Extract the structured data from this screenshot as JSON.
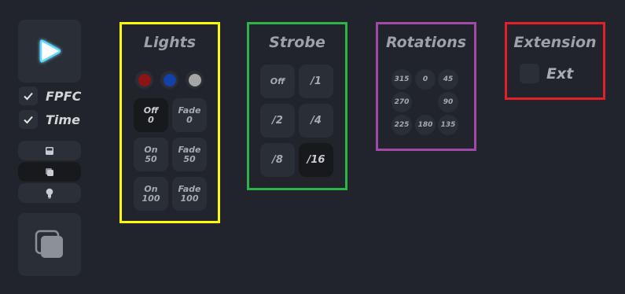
{
  "sidebar": {
    "toggles": [
      {
        "label": "FPFC",
        "checked": true
      },
      {
        "label": "Time",
        "checked": true
      }
    ],
    "play_icon": "play-icon",
    "layers_icon": "layers-icon"
  },
  "lights": {
    "title": "Lights",
    "colors": [
      "#8b1414",
      "#1540a8",
      "#a6a6a6"
    ],
    "buttons": [
      {
        "line1": "Off",
        "line2": "0"
      },
      {
        "line1": "Fade",
        "line2": "0"
      },
      {
        "line1": "On",
        "line2": "50"
      },
      {
        "line1": "Fade",
        "line2": "50"
      },
      {
        "line1": "On",
        "line2": "100"
      },
      {
        "line1": "Fade",
        "line2": "100"
      }
    ]
  },
  "strobe": {
    "title": "Strobe",
    "buttons": [
      "Off",
      "/1",
      "/2",
      "/4",
      "/8",
      "/16"
    ]
  },
  "rotations": {
    "title": "Rotations",
    "values": [
      "315",
      "0",
      "45",
      "270",
      "90",
      "225",
      "180",
      "135"
    ]
  },
  "extension": {
    "title": "Extension",
    "toggle_label": "Ext",
    "checked": false
  },
  "colors": {
    "lights_border": "#ffff00",
    "strobe_border": "#2eb34a",
    "rotations_border": "#a04aa8",
    "extension_border": "#e0202a",
    "accent_play": "#5ed8ff"
  }
}
